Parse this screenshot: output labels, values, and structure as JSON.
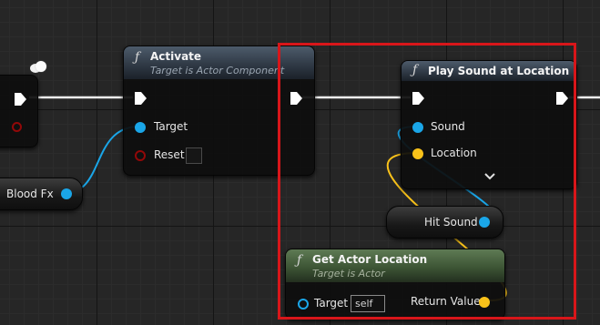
{
  "nodes": {
    "activate": {
      "icon": "function-icon",
      "title": "Activate",
      "subtitle": "Target is Actor Component",
      "pins": {
        "target": "Target",
        "reset": "Reset"
      }
    },
    "play_sound": {
      "icon": "function-icon",
      "title": "Play Sound at Location",
      "pins": {
        "sound": "Sound",
        "location": "Location"
      }
    },
    "get_actor_location": {
      "icon": "function-icon",
      "title": "Get Actor Location",
      "subtitle": "Target is Actor",
      "pins": {
        "target": "Target",
        "target_default": "self",
        "return_value": "Return Value"
      }
    },
    "blood_fx": {
      "label": "Blood Fx"
    },
    "hit_sound": {
      "label": "Hit Sound"
    }
  },
  "colors": {
    "exec": "#ffffff",
    "object_pin": "#1aa6e8",
    "struct_pin": "#f9c21a",
    "bool_pin": "#920808",
    "highlight": "#d8161a"
  }
}
